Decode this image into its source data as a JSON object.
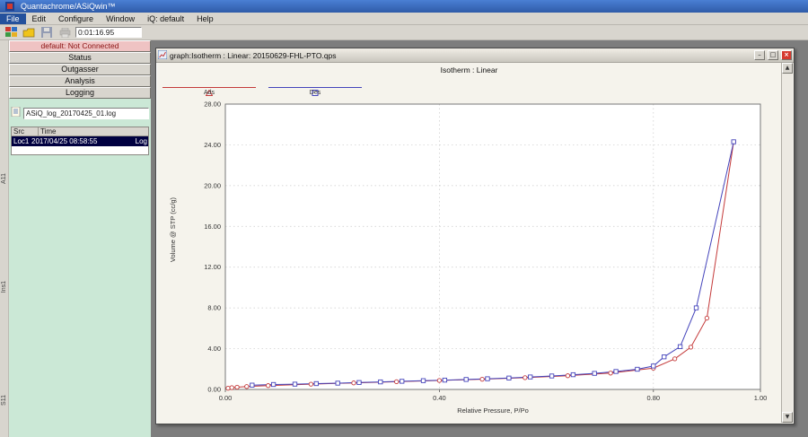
{
  "window": {
    "title": "Quantachrome/ASiQwin™"
  },
  "menu": {
    "items": [
      "File",
      "Edit",
      "Configure",
      "Window",
      "iQ: default",
      "Help"
    ],
    "active": "File"
  },
  "toolbar": {
    "timer": "0:01:16.95"
  },
  "icons": {
    "minimize": "–",
    "maximize": "□",
    "close": "×",
    "scroll_up": "▲",
    "scroll_down": "▼"
  },
  "sidebar": {
    "connection": "default: Not Connected",
    "buttons": [
      "Status",
      "Outgasser",
      "Analysis",
      "Logging"
    ],
    "log_file": "ASiQ_log_20170425_01.log",
    "table": {
      "columns": [
        "Src",
        "Time"
      ],
      "rows": [
        {
          "src": "Loc1",
          "time": "2017/04/25 08:58:55",
          "tag": "Log"
        }
      ]
    },
    "vertical_tabs": [
      "A11",
      "Ins1",
      "S11"
    ]
  },
  "graph_window": {
    "title": "graph:Isotherm :  Linear: 20150629-FHL-PTO.qps"
  },
  "chart_data": {
    "type": "line",
    "title": "Isotherm :  Linear",
    "xlabel": "Relative Pressure, P/Po",
    "ylabel": "Volume @ STP (cc/g)",
    "xlim": [
      0,
      1.0
    ],
    "ylim": [
      0,
      28
    ],
    "xticks": [
      0.0,
      0.4,
      0.8,
      1.0
    ],
    "yticks": [
      0,
      4,
      8,
      12,
      16,
      20,
      24,
      28
    ],
    "xgrid": [
      0.4,
      0.8
    ],
    "grid": "dashed",
    "legend_position": "top-left",
    "legend": [
      {
        "name": "Ads",
        "color": "#c43a3a",
        "marker": "triangle"
      },
      {
        "name": "Des",
        "color": "#4444bb",
        "marker": "square"
      }
    ],
    "series": [
      {
        "name": "Ads",
        "color": "#c43a3a",
        "marker": "circle",
        "points": [
          [
            0.005,
            0.12
          ],
          [
            0.012,
            0.18
          ],
          [
            0.022,
            0.22
          ],
          [
            0.04,
            0.28
          ],
          [
            0.08,
            0.38
          ],
          [
            0.16,
            0.52
          ],
          [
            0.24,
            0.64
          ],
          [
            0.32,
            0.76
          ],
          [
            0.4,
            0.88
          ],
          [
            0.48,
            1.0
          ],
          [
            0.56,
            1.15
          ],
          [
            0.64,
            1.35
          ],
          [
            0.72,
            1.6
          ],
          [
            0.8,
            2.1
          ],
          [
            0.84,
            3.0
          ],
          [
            0.87,
            4.15
          ],
          [
            0.9,
            7.0
          ],
          [
            0.95,
            24.3
          ]
        ]
      },
      {
        "name": "Des",
        "color": "#4444bb",
        "marker": "square",
        "points": [
          [
            0.05,
            0.42
          ],
          [
            0.09,
            0.48
          ],
          [
            0.13,
            0.52
          ],
          [
            0.17,
            0.57
          ],
          [
            0.21,
            0.62
          ],
          [
            0.25,
            0.68
          ],
          [
            0.29,
            0.74
          ],
          [
            0.33,
            0.8
          ],
          [
            0.37,
            0.86
          ],
          [
            0.41,
            0.92
          ],
          [
            0.45,
            0.98
          ],
          [
            0.49,
            1.05
          ],
          [
            0.53,
            1.12
          ],
          [
            0.57,
            1.22
          ],
          [
            0.61,
            1.32
          ],
          [
            0.65,
            1.44
          ],
          [
            0.69,
            1.58
          ],
          [
            0.73,
            1.76
          ],
          [
            0.77,
            1.98
          ],
          [
            0.8,
            2.3
          ],
          [
            0.82,
            3.2
          ],
          [
            0.85,
            4.2
          ],
          [
            0.88,
            8.0
          ],
          [
            0.95,
            24.3
          ]
        ]
      }
    ]
  }
}
